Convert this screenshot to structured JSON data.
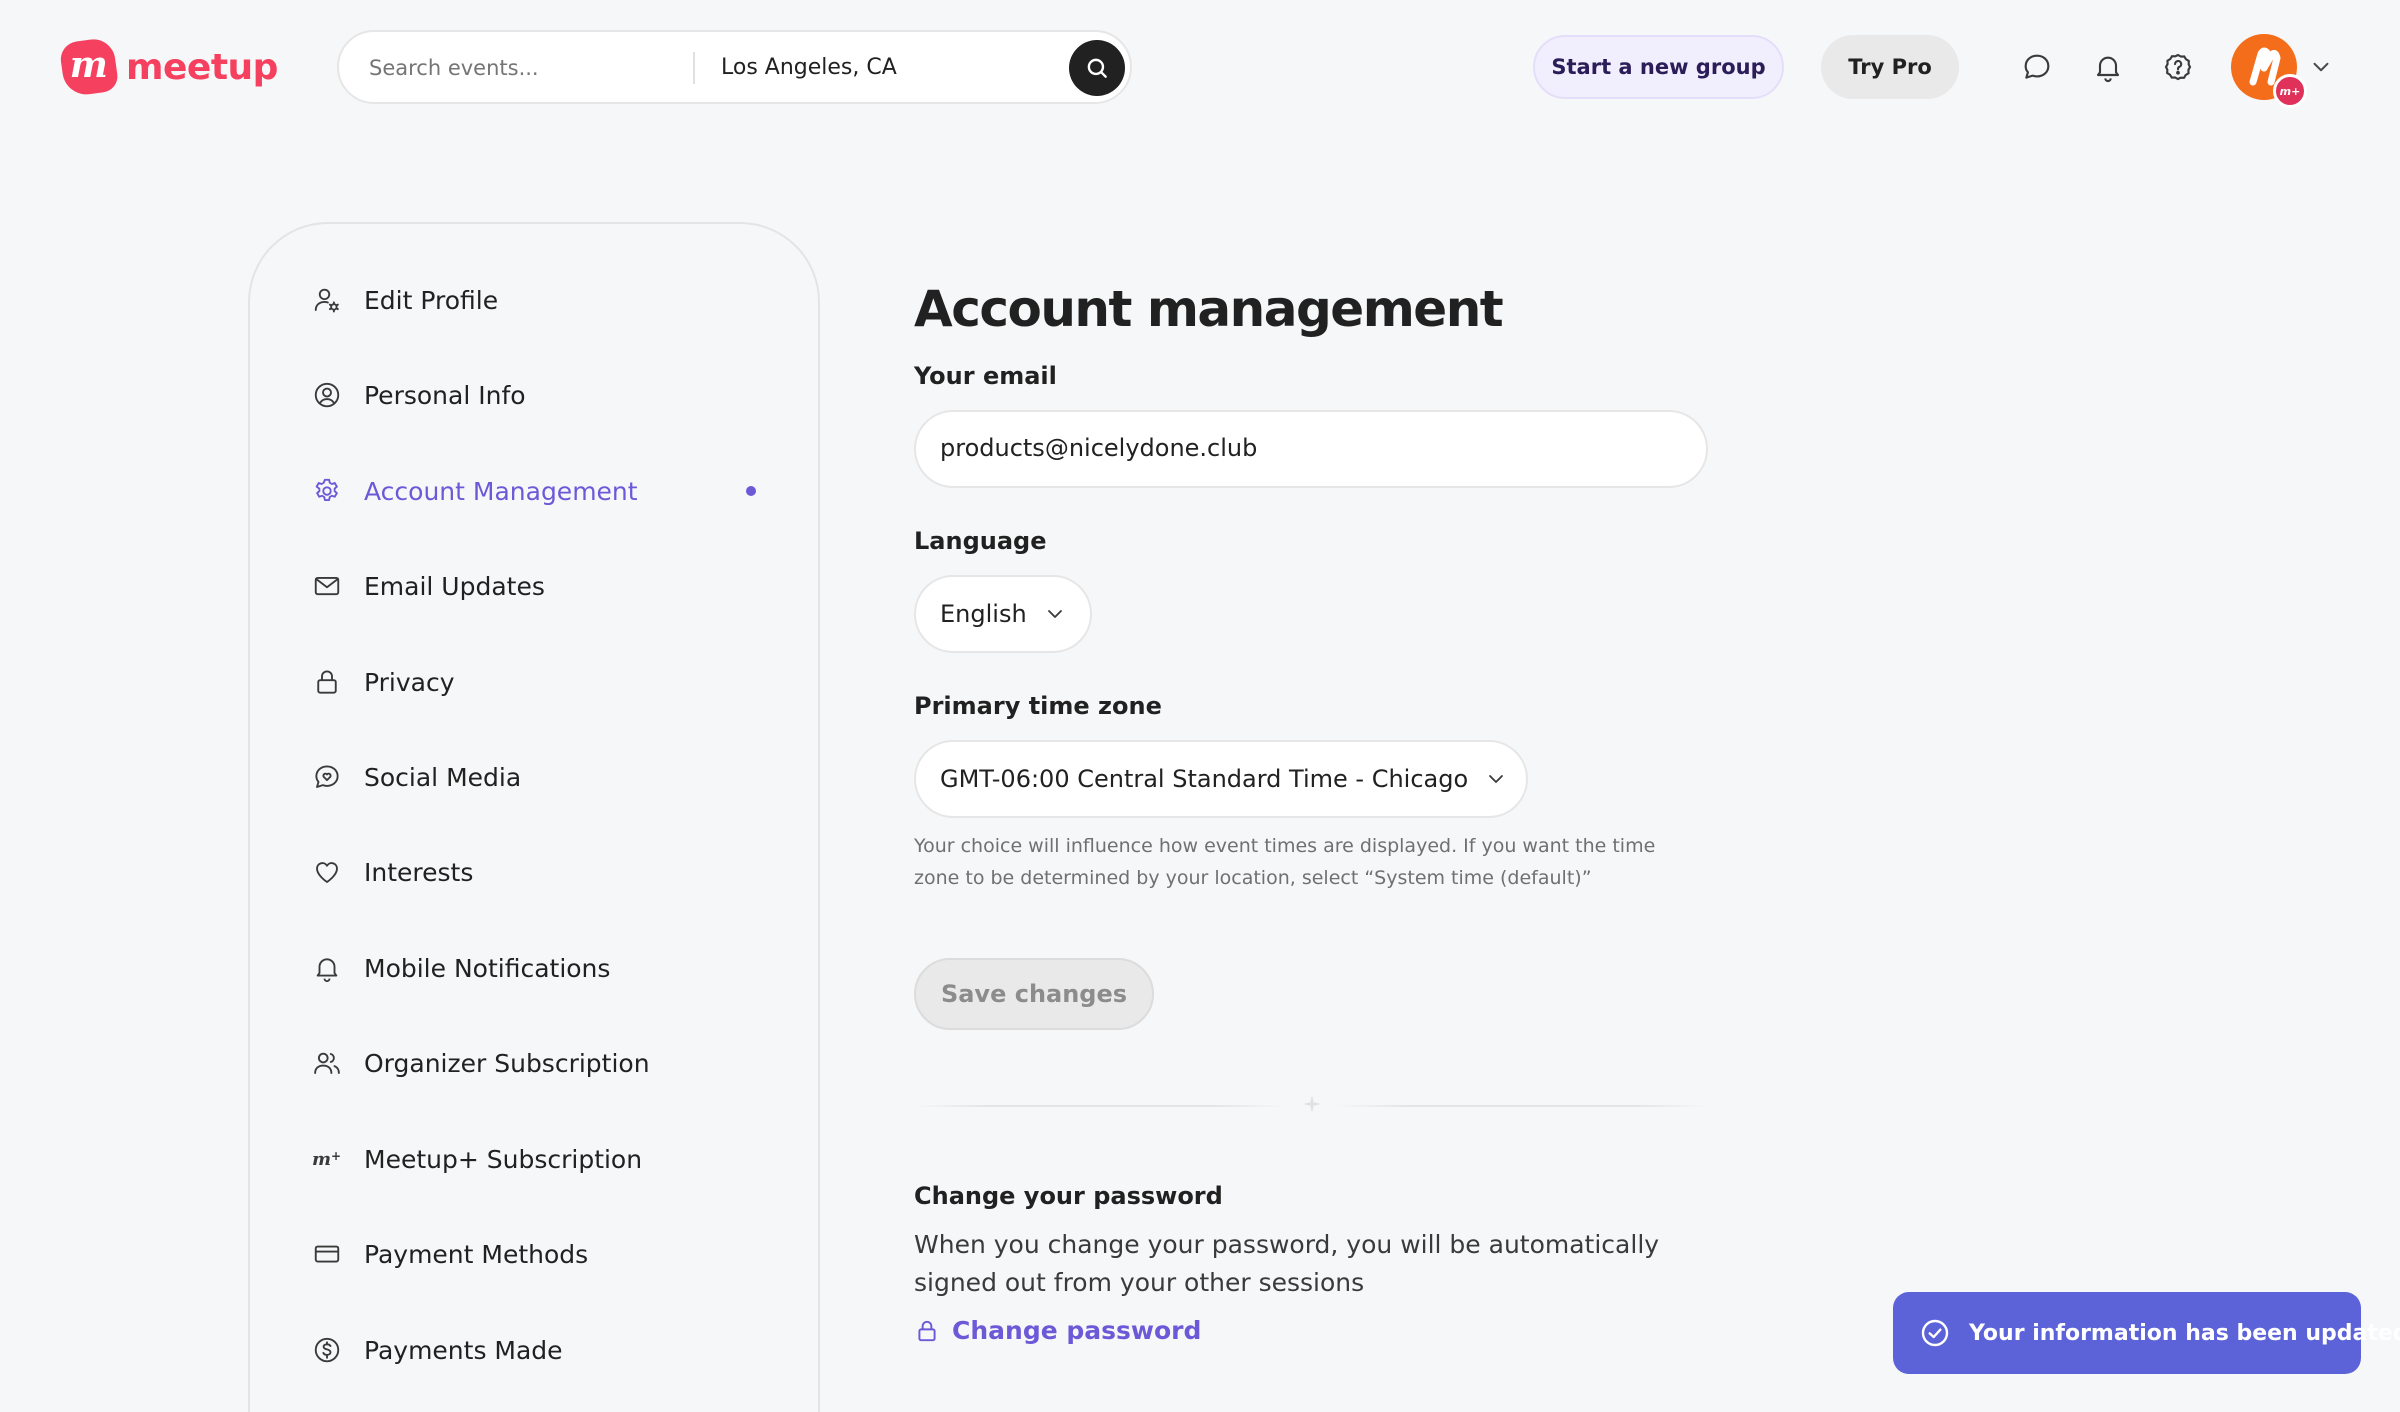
{
  "header": {
    "logo_mark": "m",
    "logo_text": "meetup",
    "search_placeholder": "Search events...",
    "location": "Los Angeles, CA",
    "start_group_label": "Start a new group",
    "try_pro_label": "Try Pro",
    "avatar_badge": "m+",
    "icons": [
      "search-icon",
      "chat-icon",
      "bell-icon",
      "help-icon",
      "chevron-down-icon"
    ]
  },
  "sidebar": {
    "items": [
      {
        "label": "Edit Profile",
        "icon": "user-edit-icon"
      },
      {
        "label": "Personal Info",
        "icon": "user-circle-icon"
      },
      {
        "label": "Account Management",
        "icon": "gear-icon",
        "active": true
      },
      {
        "label": "Email Updates",
        "icon": "mail-icon"
      },
      {
        "label": "Privacy",
        "icon": "lock-icon"
      },
      {
        "label": "Social Media",
        "icon": "chat-heart-icon"
      },
      {
        "label": "Interests",
        "icon": "heart-icon"
      },
      {
        "label": "Mobile Notifications",
        "icon": "bell-icon"
      },
      {
        "label": "Organizer Subscription",
        "icon": "users-icon"
      },
      {
        "label": "Meetup+ Subscription",
        "icon": "meetup-plus-icon"
      },
      {
        "label": "Payment Methods",
        "icon": "credit-card-icon"
      },
      {
        "label": "Payments Made",
        "icon": "dollar-icon"
      }
    ]
  },
  "main": {
    "title": "Account management",
    "email_label": "Your email",
    "email_value": "products@nicelydone.club",
    "language_label": "Language",
    "language_value": "English",
    "timezone_label": "Primary time zone",
    "timezone_value": "GMT-06:00 Central Standard Time - Chicago",
    "timezone_help": "Your choice will influence how event times are displayed. If you want the time zone to be determined by your location, select “System time (default)”",
    "save_label": "Save changes",
    "password_title": "Change your password",
    "password_desc": "When you change your password, you will be automatically signed out from your other sessions",
    "password_link": "Change password"
  },
  "toast": {
    "message": "Your information has been updated"
  },
  "colors": {
    "brand": "#f6405f",
    "accent": "#6c59d8",
    "toast": "#5c63d8",
    "background": "#f6f7f8"
  }
}
